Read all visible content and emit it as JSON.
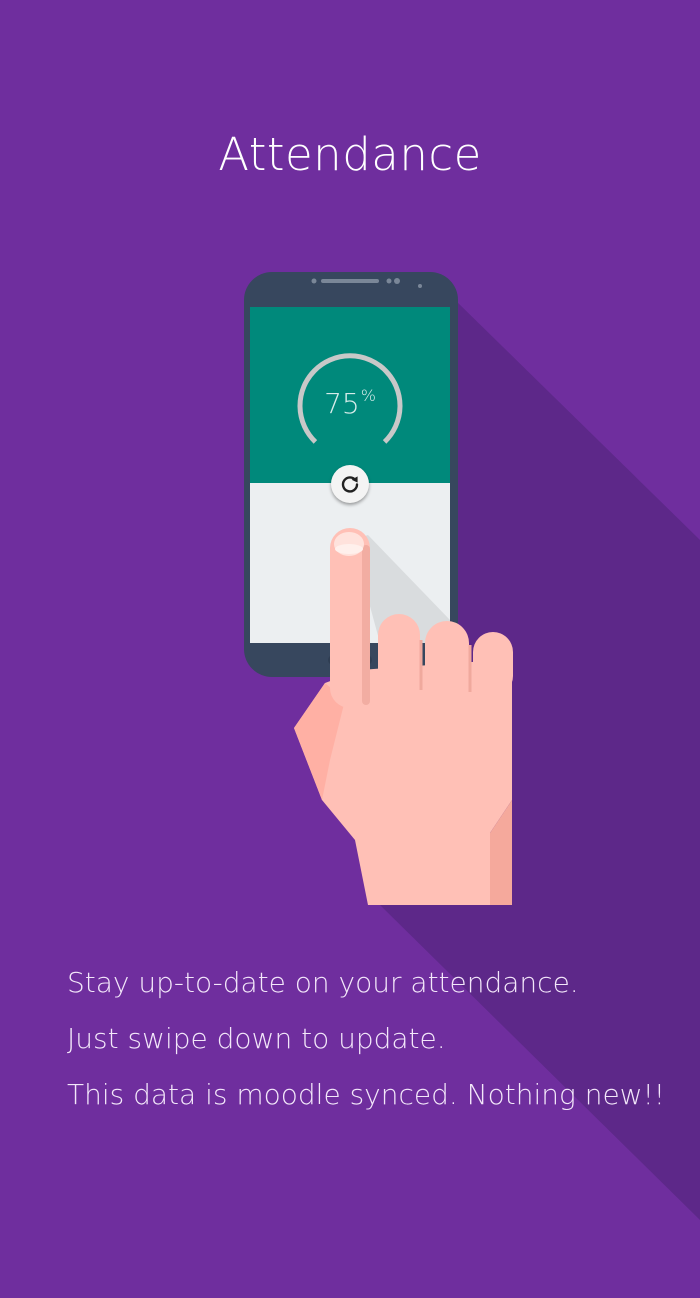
{
  "page": {
    "title": "Attendance",
    "description_lines": [
      "Stay up-to-date on your attendance.",
      "Just swipe down to update.",
      "This data is moodle synced. Nothing new!!"
    ]
  },
  "phone": {
    "attendance_value": "75",
    "percent_symbol": "%",
    "attendance_fraction": 0.75
  },
  "icons": {
    "refresh": "refresh-icon",
    "phone": "smartphone-illustration",
    "hand": "pointing-hand-illustration"
  },
  "colors": {
    "background": "#6f2e9e",
    "long_shadow": "#5d2889",
    "phone_body": "#37475e",
    "screen_top": "#00897b",
    "screen_bottom": "#eceff1",
    "gauge": "#c8c8c8",
    "skin": "#ffc0b6"
  }
}
